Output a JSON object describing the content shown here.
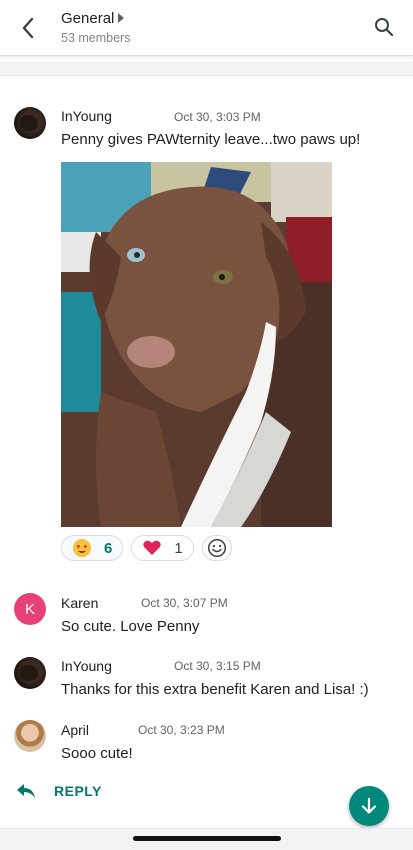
{
  "header": {
    "title": "General",
    "subtitle": "53 members",
    "back_icon": "chevron-left-icon",
    "search_icon": "search-icon"
  },
  "messages": [
    {
      "sender": "InYoung",
      "time": "Oct 30, 3:03 PM",
      "text": "Penny gives PAWternity leave...two paws up!",
      "avatar": "dog-photo"
    },
    {
      "sender": "Karen",
      "time": "Oct 30, 3:07 PM",
      "text": "So cute. Love Penny",
      "avatar_letter": "K"
    },
    {
      "sender": "InYoung",
      "time": "Oct 30, 3:15 PM",
      "text": "Thanks for this extra benefit Karen and Lisa!  :)",
      "avatar": "dog-photo"
    },
    {
      "sender": "April",
      "time": "Oct 30, 3:23 PM",
      "text": "Sooo cute!",
      "avatar": "person-photo"
    }
  ],
  "reactions": [
    {
      "emoji": "heart-eyes-emoji",
      "count": "6"
    },
    {
      "emoji": "red-heart-emoji",
      "count": "1"
    }
  ],
  "reply": {
    "label": "REPLY",
    "icon": "reply-arrow-icon"
  },
  "colors": {
    "accent": "#00796b",
    "fab": "#00897b",
    "karen_avatar": "#e8417a"
  }
}
